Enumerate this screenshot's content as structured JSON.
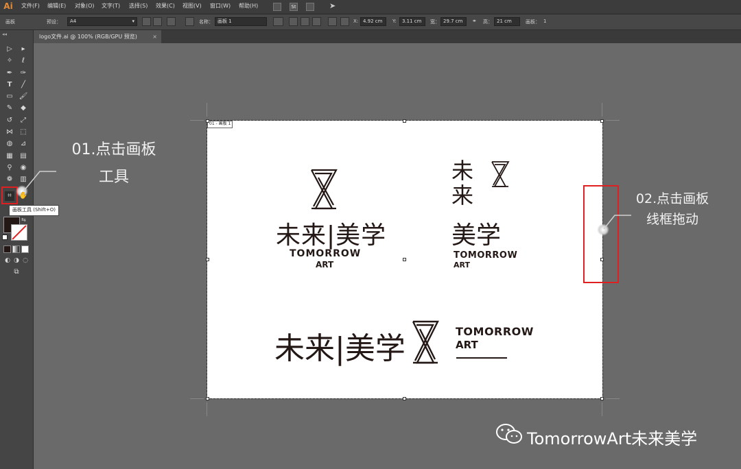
{
  "app": {
    "logo": "Ai"
  },
  "menu": [
    "文件(F)",
    "编辑(E)",
    "对象(O)",
    "文字(T)",
    "选择(S)",
    "效果(C)",
    "视图(V)",
    "窗口(W)",
    "帮助(H)"
  ],
  "menubar_icon": "St",
  "controlbar": {
    "panel_label": "画板",
    "preset_label": "预设：",
    "preset_value": "A4",
    "name_label": "名称：",
    "name_value": "画板 1",
    "x_label": "X:",
    "x_value": "4.92 cm",
    "y_label": "Y:",
    "y_value": "3.11 cm",
    "w_label": "宽：",
    "w_value": "29.7 cm",
    "h_label": "高：",
    "h_value": "21 cm",
    "artboards_label": "画板：",
    "artboards_value": "1"
  },
  "document": {
    "tab_title": "logo文件.ai @ 100% (RGB/GPU 预览)",
    "artboard_label": "01 - 画板 1"
  },
  "tooltip": "画板工具 (Shift+O)",
  "logos": {
    "zh_name": "未来|美学",
    "zh_part1": "未来",
    "zh_part2": "美学",
    "zh_char1": "未",
    "zh_char2": "来",
    "en_line1": "TOMORROW",
    "en_line2": "ART"
  },
  "annotations": {
    "step1_line1": "01.点击画板",
    "step1_line2": "工具",
    "step2_line1": "02.点击画板",
    "step2_line2": "线框拖动"
  },
  "watermark": "TomorrowArt未来美学",
  "colors": {
    "accent_red": "#e02020",
    "logo_dark": "#231815",
    "ui_dark": "#3c3c3c"
  }
}
